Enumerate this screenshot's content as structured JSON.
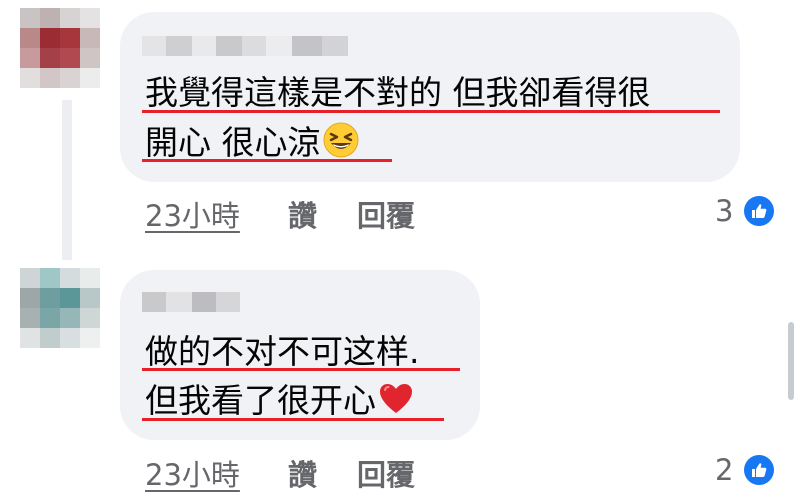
{
  "comments": [
    {
      "line1": "我覺得這樣是不對的 但我卻看得很",
      "line2": "開心 很心涼",
      "emoji": "grinning-squinting-face",
      "time": "23小時",
      "like_label": "讚",
      "reply_label": "回覆",
      "like_count": "3"
    },
    {
      "line1": "做的不对不可这样.",
      "line2": "但我看了很开心",
      "emoji": "red-heart",
      "time": "23小時",
      "like_label": "讚",
      "reply_label": "回覆",
      "like_count": "2"
    }
  ],
  "colors": {
    "bubble": "#f0f2f5",
    "underline": "#e8202a",
    "like_blue": "#1877f2",
    "meta_gray": "#65676b"
  },
  "avatars": [
    [
      "#c9c3c3",
      "#bdb1b1",
      "#d7d3d3",
      "#e4e2e2",
      "#b98888",
      "#9b2c33",
      "#a6353c",
      "#c9b8b8",
      "#c79b9b",
      "#a44048",
      "#b04a50",
      "#cfc5c5",
      "#e3dede",
      "#d2c6c6",
      "#d9d3d3",
      "#ececec"
    ],
    [
      "#cfd5d6",
      "#9fc7c6",
      "#d5dcdd",
      "#e8eceb",
      "#9ea7a8",
      "#6f9ea0",
      "#5b9799",
      "#b8c7c8",
      "#a8b1b2",
      "#7aa6a8",
      "#96b7b8",
      "#cfd6d6",
      "#dfe3e3",
      "#c1cccd",
      "#d9dfe0",
      "#eef0f0"
    ]
  ]
}
